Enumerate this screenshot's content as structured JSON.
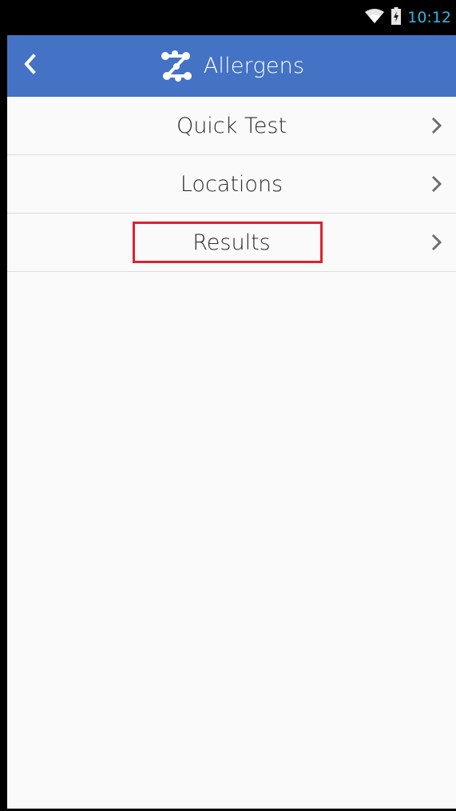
{
  "status_bar": {
    "time": "10:12",
    "icons": [
      "wifi-icon",
      "battery-charging-icon"
    ],
    "time_color": "#33b5e5"
  },
  "app_bar": {
    "title": "Allergens",
    "back_icon": "chevron-left-icon",
    "logo_icon": "molecule-logo-icon",
    "background_color": "#4472c4"
  },
  "menu": {
    "items": [
      {
        "label": "Quick Test",
        "icon": "chevron-right-icon"
      },
      {
        "label": "Locations",
        "icon": "chevron-right-icon"
      },
      {
        "label": "Results",
        "icon": "chevron-right-icon",
        "highlighted": true
      }
    ],
    "highlight_color": "#e0202e"
  }
}
